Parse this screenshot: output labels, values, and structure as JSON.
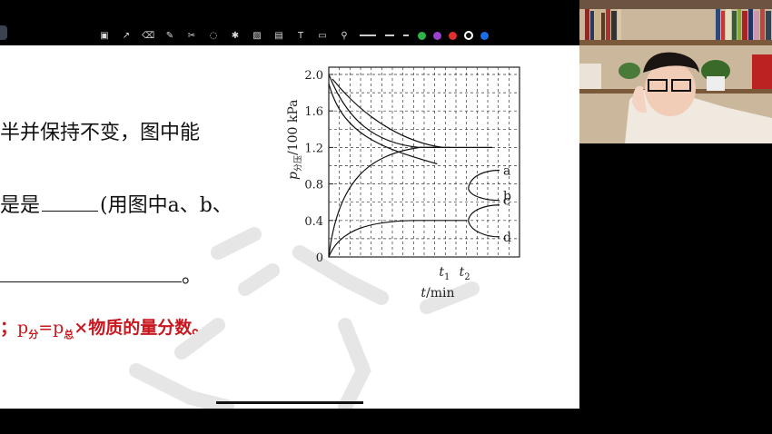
{
  "toolbar": {
    "tools": [
      "screenshot-icon",
      "pointer-icon",
      "eraser-icon",
      "pen-icon",
      "cut-icon",
      "lasso-icon",
      "shape-icon",
      "image-icon",
      "media-icon",
      "text-icon",
      "note-icon",
      "link-icon"
    ],
    "colors": [
      "#ffffff",
      "#ffffff",
      "#2db34a",
      "#9b3fcf",
      "#e03030",
      "#111111",
      "#1a6ee6"
    ]
  },
  "question": {
    "line1": "半并保持不变，图中能",
    "line2_pre": "是是",
    "line2_post": "(用图中a、b、",
    "line3_end": "。",
    "hint_prefix": "；",
    "hint_p": "p",
    "hint_sub1": "分",
    "hint_eq": "=p",
    "hint_sub2": "总",
    "hint_rest": "×物质的量分数。"
  },
  "chart_data": {
    "type": "line",
    "title": "",
    "ylabel": "p分压/100 kPa",
    "ylabel_var": "p",
    "ylabel_sub": "分压",
    "ylabel_unit": "/100 kPa",
    "xlabel": "t/min",
    "yticks": [
      "0",
      "0.4",
      "0.8",
      "1.2",
      "1.6",
      "2.0"
    ],
    "xticks": [
      "t1",
      "t2"
    ],
    "ylim": [
      0,
      2.0
    ],
    "grid": true,
    "series_labels": [
      "a",
      "b",
      "c",
      "d"
    ],
    "series_end_values": {
      "a": 0.95,
      "b": 0.62,
      "c": 0.57,
      "d": 0.22
    }
  }
}
